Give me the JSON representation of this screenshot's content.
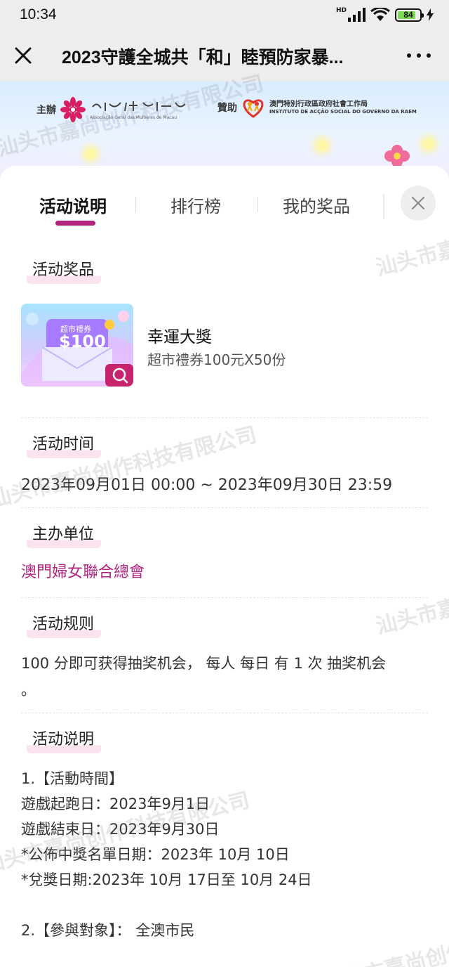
{
  "status_bar": {
    "time": "10:34",
    "network_label": "HD",
    "battery": "84",
    "battery_fraction": 0.84
  },
  "titlebar": {
    "title": "2023守護全城共「和」睦預防家暴..."
  },
  "banner": {
    "host_label": "主辦",
    "host_org_sub": "Associação Geral das Mulheres de Macau",
    "sponsor_label": "贊助",
    "sponsor_org": "澳門特別行政區政府社會工作局",
    "sponsor_org_sub": "INSTITUTO DE ACÇÃO SOCIAL DO GOVERNO DA RAEM"
  },
  "tabs": [
    {
      "label": "活动说明",
      "active": true
    },
    {
      "label": "排行榜",
      "active": false
    },
    {
      "label": "我的奖品",
      "active": false
    }
  ],
  "sections": {
    "prizes": {
      "title": "活动奖品",
      "prize_name": "幸運大獎",
      "prize_desc": "超市禮券100元X50份",
      "voucher_label": "超市禮券",
      "voucher_amount": "$100"
    },
    "time": {
      "title": "活动时间",
      "value": "2023年09月01日 00:00 ~ 2023年09月30日 23:59"
    },
    "organizer": {
      "title": "主办单位",
      "value": "澳門婦女聯合總會"
    },
    "rules": {
      "title": "活动规则",
      "line1": "100 分即可获得抽奖机会， 每人 每日 有 1 次 抽奖机会",
      "line2": "。"
    },
    "description": {
      "title": "活动说明",
      "lines": [
        "1.【活動時間】",
        "遊戲起跑日：2023年9月1日",
        "遊戲結束日：2023年9月30日",
        "*公佈中獎名單日期：2023年 10月 10日",
        "*兌獎日期:2023年 10月 17日至 10月 24日",
        "",
        "2.【參與對象】： 全澳市民"
      ]
    }
  },
  "watermark_text": "汕头市嘉尚创作科技有限公司"
}
